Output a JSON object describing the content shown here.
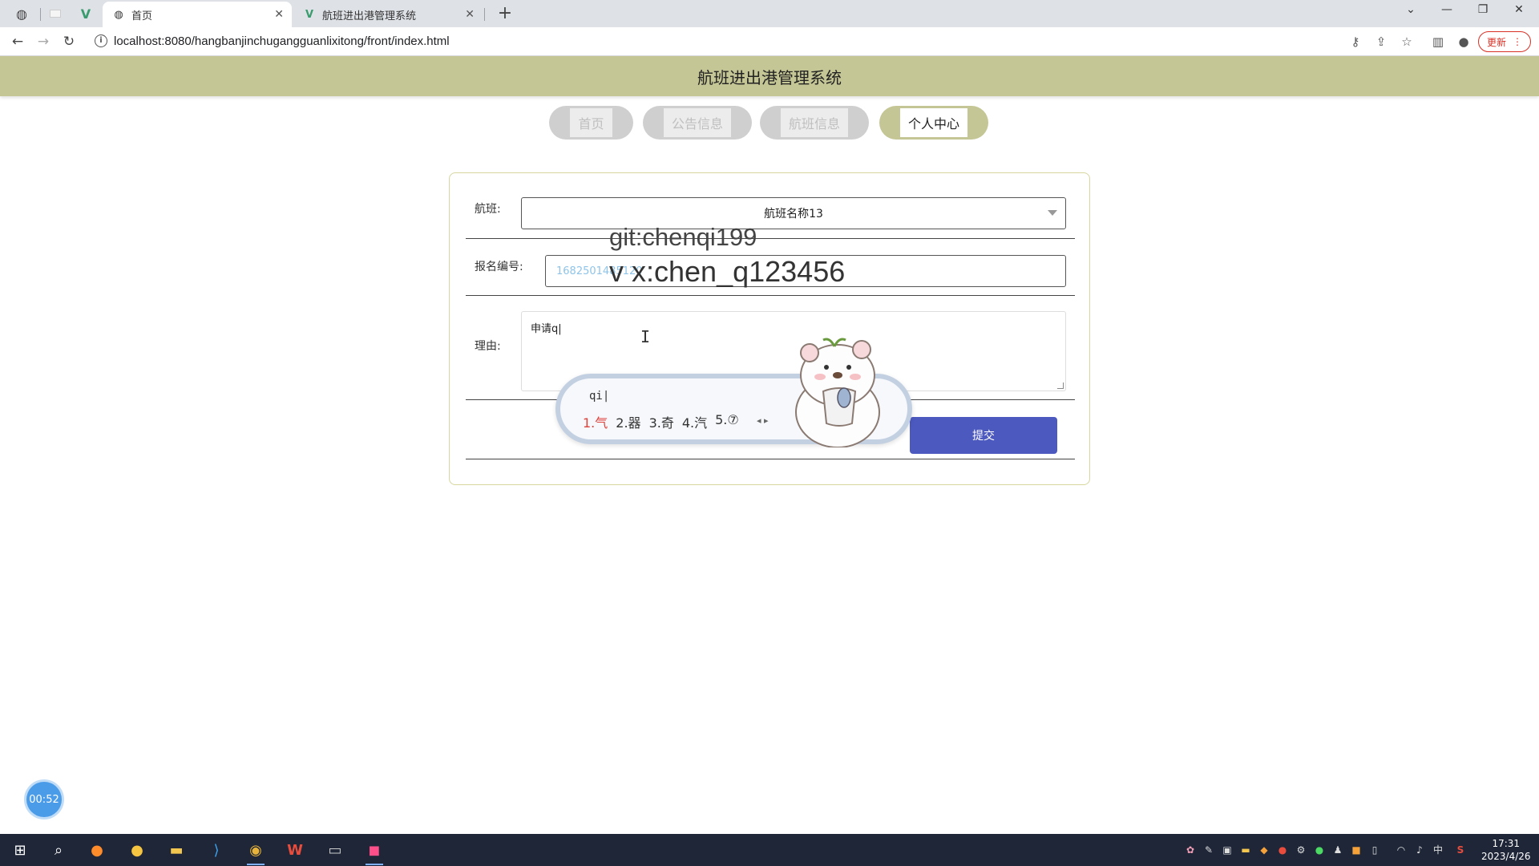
{
  "browser": {
    "tabs": [
      {
        "title": "首页",
        "active": true
      },
      {
        "title": "航班进出港管理系统",
        "active": false
      }
    ],
    "url": "localhost:8080/hangbanjinchugangguanlixitong/front/index.html",
    "update_label": "更新"
  },
  "header": {
    "title": "航班进出港管理系统"
  },
  "nav": [
    {
      "label": "首页",
      "active": false
    },
    {
      "label": "公告信息",
      "active": false
    },
    {
      "label": "航班信息",
      "active": false
    },
    {
      "label": "个人中心",
      "active": true
    }
  ],
  "form": {
    "flight_label": "航班:",
    "flight_value": "航班名称13",
    "reg_label": "报名编号:",
    "reg_value": "1682501485120",
    "reason_label": "理由:",
    "reason_value": "申请q|",
    "submit_label": "提交"
  },
  "watermark": {
    "line1": "git:chenqi199",
    "line2": "v x:chen_q123456"
  },
  "ime": {
    "composition": "qi|",
    "candidates": [
      {
        "label": "1.气",
        "selected": true
      },
      {
        "label": "2.器",
        "selected": false
      },
      {
        "label": "3.奇",
        "selected": false
      },
      {
        "label": "4.汽",
        "selected": false
      },
      {
        "label": "5.⑦",
        "selected": false
      }
    ]
  },
  "timer": "00:52",
  "taskbar": {
    "time": "17:31",
    "date": "2023/4/26",
    "ime_indicator": "中"
  },
  "colors": {
    "header_bg": "#c5c695",
    "submit_bg": "#4c59bf",
    "update_red": "#d93025"
  }
}
